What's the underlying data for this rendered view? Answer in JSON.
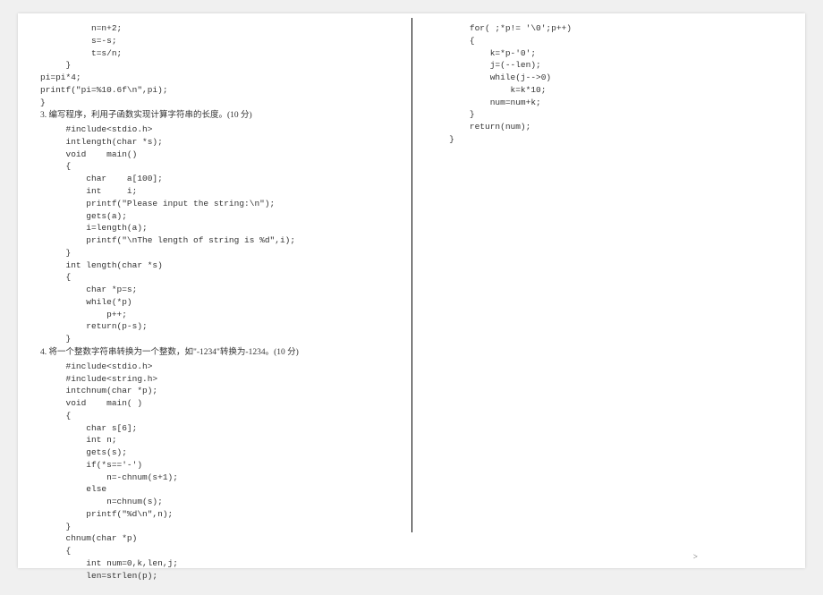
{
  "col_left": {
    "block1": "          n=n+2;\n          s=-s;\n          t=s/n;\n     }\npi=pi*4;\nprintf(\"pi=%10.6f\\n\",pi);\n}",
    "q3_title": "3.  编写程序，利用子函数实现计算字符串的长度。(10 分)",
    "q3_code": "     #include<stdio.h>\n     intlength(char *s);\n     void    main()\n     {\n         char    a[100];\n         int     i;\n         printf(\"Please input the string:\\n\");\n         gets(a);\n         i=length(a);\n         printf(\"\\nThe length of string is %d\",i);\n     }\n     int length(char *s)\n     {\n         char *p=s;\n         while(*p)\n             p++;\n         return(p-s);\n     }",
    "q4_title": "4.  将一个整数字符串转换为一个整数，如\"-1234\"转换为-1234。(10 分)",
    "q4_code": "     #include<stdio.h>\n     #include<string.h>\n     intchnum(char *p);\n     void    main( )\n     {\n         char s[6];\n         int n;\n         gets(s);\n         if(*s=='-')\n             n=-chnum(s+1);\n         else\n             n=chnum(s);\n         printf(\"%d\\n\",n);\n     }\n     chnum(char *p)\n     {\n         int num=0,k,len,j;\n         len=strlen(p);"
  },
  "col_right": {
    "block1": "       for( ;*p!= '\\0';p++)\n       {\n           k=*p-'0';\n           j=(--len);\n           while(j-->0)\n               k=k*10;\n           num=num+k;\n       }\n       return(num);\n   }"
  },
  "page_num": ">"
}
